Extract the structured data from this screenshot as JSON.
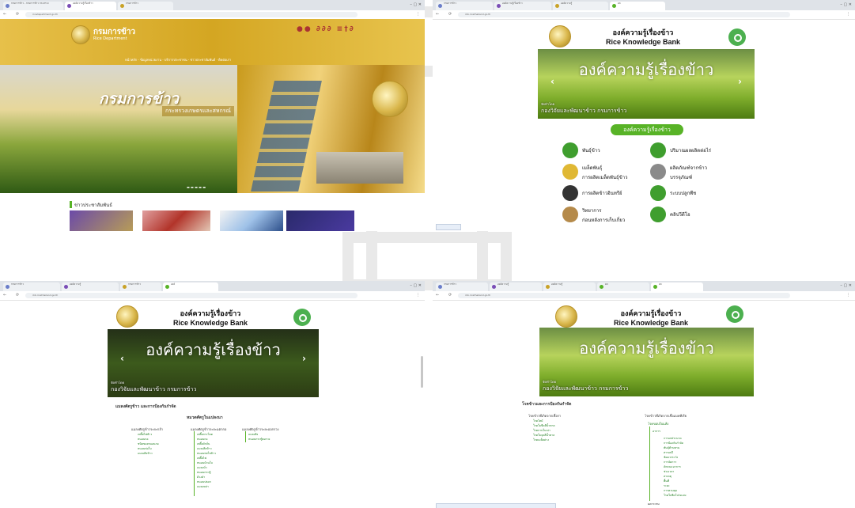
{
  "colors": {
    "green": "#58b327",
    "gold": "#c9a227",
    "link": "#1e7d1e"
  },
  "tl": {
    "tabs": [
      "กรมการข้าว - กรมการข้าว กระทรวง",
      "องค์ความรู้เรื่องข้าว",
      "กรมการข้าว"
    ],
    "url": "ricedepartment.go.th",
    "site_name": "กรมการข้าว",
    "site_name_en": "Rice Department",
    "menu": "หน้าหลัก · ข้อมูลหน่วยงาน · บริการประชาชน · ข่าวประชาสัมพันธ์ · ติดต่อเรา",
    "hero_title": "กรมการข้าว",
    "hero_sub": "กระทรวงเกษตรและสหกรณ์",
    "news_header": "ข่าวประชาสัมพันธ์"
  },
  "rk": {
    "title_th": "องค์ความรู้เรื่องข้าว",
    "title_en": "Rice Knowledge Bank",
    "banner_title": "องค์ความรู้เรื่องข้าว",
    "banner_cap1": "จัดทำโดย",
    "banner_cap2": "กองวิจัยและพัฒนาข้าว กรมการข้าว",
    "url": "rkb.ricethailand.go.th"
  },
  "tr": {
    "tabs": [
      "กรมการข้าว",
      "องค์ความรู้เรื่องข้าว",
      "องค์ความรู้",
      "ผล"
    ],
    "pill": "องค์ความรู้เรื่องข้าว",
    "items": [
      {
        "label": "พันธุ์ข้าว",
        "icon": "rice-variety-icon"
      },
      {
        "label": "ปริมาณผลผลิตต่อไร่",
        "icon": "yield-icon"
      },
      {
        "label": "เมล็ดพันธุ์",
        "label2": "การผลิตเมล็ดพันธุ์ข้าว",
        "icon": "seed-icon"
      },
      {
        "label": "ผลิตภัณฑ์จากข้าว",
        "label2": "บรรจุภัณฑ์",
        "icon": "product-icon"
      },
      {
        "label": "การผลิตข้าวอินทรีย์",
        "icon": "organic-icon"
      },
      {
        "label": "ระบบปลูกพืช",
        "icon": "planting-icon"
      },
      {
        "label": "วิทยาการ",
        "label2": "ก่อนหลังการเก็บเกี่ยว",
        "icon": "harvest-icon"
      },
      {
        "label": "คลิปวีดีโอ",
        "icon": "video-icon"
      }
    ]
  },
  "bl": {
    "tabs": [
      "กรมการข้าว",
      "องค์ความรู้",
      "กรมการข้าว",
      "องค์"
    ],
    "crumb": "แมลงศัตรูข้าว และการป้องกันกำจัด",
    "section": "หมวดศัตรูในแปลงนา",
    "cols": [
      {
        "head": "แมลงศัตรูข้าวระยะกล้า",
        "items": [
          "เพลี้ยไฟข้าว",
          "หนอนกอ",
          "ชนิดของหนอนกอ",
          "หนอนห่อใบ",
          "แมลงสิงข้าว"
        ]
      },
      {
        "head": "แมลงศัตรูข้าวระยะแตกกอ",
        "items": [
          "เพลี้ยกระโดด",
          "หนอนกอ",
          "เพลี้ยจักจั่น",
          "แมลงสิงข้าว",
          "หนอนห่อใบข้าว",
          "เพลี้ยไฟ",
          "หนอนม้วนใบ",
          "แมลงบั่ว",
          "หนอนกระทู้",
          "ด้วงดำ",
          "หนอนปลอก",
          "แมลงหล่า"
        ]
      },
      {
        "head": "แมลงศัตรูข้าวระยะออกรวง",
        "items": [
          "แมลงสิง",
          "หนอนกระทู้คอรวง"
        ]
      }
    ]
  },
  "br": {
    "tabs": [
      "กรมการข้าว",
      "องค์ความรู้",
      "องค์ความรู้",
      "ผล",
      "ผล"
    ],
    "crumb": "โรคข้าวและการป้องกันกำจัด",
    "left_head": "โรคข้าวที่เกิดจากเชื้อรา",
    "left_items": [
      "โรคไหม้",
      "โรคใบขีดสีน้ำตาล",
      "โรคกาบใบเน่า",
      "โรคใบจุดสีน้ำตาล",
      "โรคเมล็ดด่าง"
    ],
    "right_head": "โรคข้าวที่เกิดจากเชื้อแบคทีเรีย",
    "right_sub": "โรคขอบใบแห้ง",
    "right_items": [
      "อาการ",
      "การแพร่ระบาด",
      "การป้องกันกำจัด",
      "พันธุ์ต้านทาน",
      "สารเคมี",
      "ข้อควรระวัง",
      "การจัดการ",
      "ลักษณะอาการ",
      "ช่วงเวลา",
      "สาเหตุ",
      "พื้นที่",
      "ระยะ",
      "การควบคุม",
      "โรคใบขีดโปร่งแสง"
    ],
    "right_tail": "ผลกระทบ"
  }
}
